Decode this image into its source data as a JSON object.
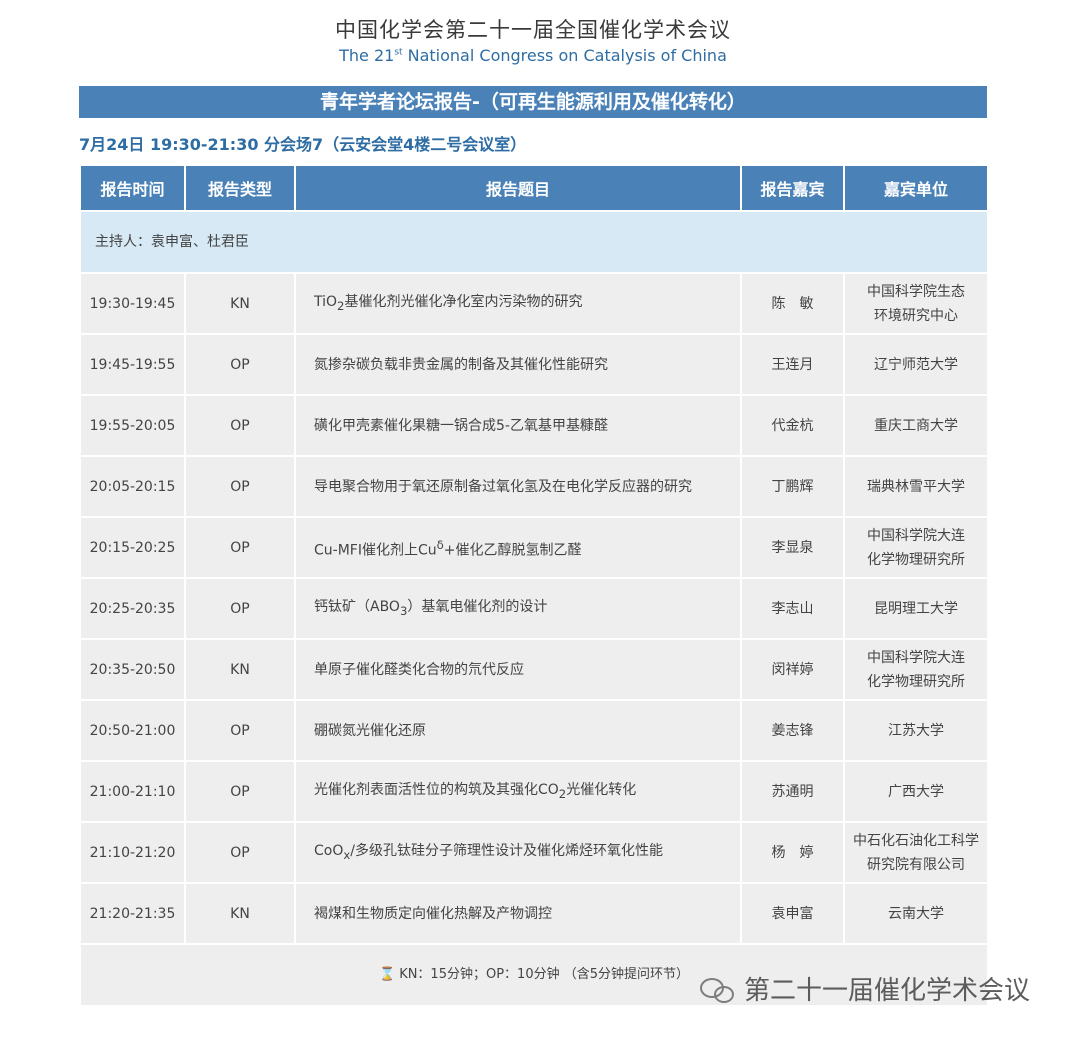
{
  "header": {
    "title_cn": "中国化学会第二十一届全国催化学术会议",
    "title_en_prefix": "The 21",
    "title_en_sup": "st",
    "title_en_suffix": " National Congress on Catalysis of China"
  },
  "banner": "青年学者论坛报告-（可再生能源利用及催化转化）",
  "session": "7月24日  19:30-21:30 分会场7（云安会堂4楼二号会议室）",
  "columns": [
    "报告时间",
    "报告类型",
    "报告题目",
    "报告嘉宾",
    "嘉宾单位"
  ],
  "host": "主持人：袁申富、杜君臣",
  "rows": [
    {
      "time": "19:30-19:45",
      "type": "KN",
      "t1": "TiO",
      "sub": "2",
      "t2": "基催化剂光催化净化室内污染物的研究",
      "speaker": "陈　敏",
      "aff1": "中国科学院生态",
      "aff2": "环境研究中心"
    },
    {
      "time": "19:45-19:55",
      "type": "OP",
      "t1": "氮掺杂碳负载非贵金属的制备及其催化性能研究",
      "sub": "",
      "t2": "",
      "speaker": "王连月",
      "aff1": "辽宁师范大学",
      "aff2": ""
    },
    {
      "time": "19:55-20:05",
      "type": "OP",
      "t1": "磺化甲壳素催化果糖一锅合成5-乙氧基甲基糠醛",
      "sub": "",
      "t2": "",
      "speaker": "代金杭",
      "aff1": "重庆工商大学",
      "aff2": ""
    },
    {
      "time": "20:05-20:15",
      "type": "OP",
      "t1": "导电聚合物用于氧还原制备过氧化氢及在电化学反应器的研究",
      "sub": "",
      "t2": "",
      "speaker": "丁鹏辉",
      "aff1": "瑞典林雪平大学",
      "aff2": ""
    },
    {
      "time": "20:15-20:25",
      "type": "OP",
      "t1": "Cu-MFI催化剂上Cu",
      "sup": "δ",
      "t2": "+催化乙醇脱氢制乙醛",
      "speaker": "李显泉",
      "aff1": "中国科学院大连",
      "aff2": "化学物理研究所"
    },
    {
      "time": "20:25-20:35",
      "type": "OP",
      "t1": "钙钛矿（ABO",
      "sub": "3",
      "t2": "）基氧电催化剂的设计",
      "speaker": "李志山",
      "aff1": "昆明理工大学",
      "aff2": ""
    },
    {
      "time": "20:35-20:50",
      "type": "KN",
      "t1": "单原子催化醛类化合物的氘代反应",
      "sub": "",
      "t2": "",
      "speaker": "闵祥婷",
      "aff1": "中国科学院大连",
      "aff2": "化学物理研究所"
    },
    {
      "time": "20:50-21:00",
      "type": "OP",
      "t1": "硼碳氮光催化还原",
      "sub": "",
      "t2": "",
      "speaker": "姜志锋",
      "aff1": "江苏大学",
      "aff2": ""
    },
    {
      "time": "21:00-21:10",
      "type": "OP",
      "t1": "光催化剂表面活性位的构筑及其强化CO",
      "sub": "2",
      "t2": "光催化转化",
      "speaker": "苏通明",
      "aff1": "广西大学",
      "aff2": ""
    },
    {
      "time": "21:10-21:20",
      "type": "OP",
      "t1": "CoO",
      "sub": "x",
      "t2": "/多级孔钛硅分子筛理性设计及催化烯烃环氧化性能",
      "speaker": "杨　婷",
      "aff1": "中石化石油化工科学",
      "aff2": "研究院有限公司"
    },
    {
      "time": "21:20-21:35",
      "type": "KN",
      "t1": "褐煤和生物质定向催化热解及产物调控",
      "sub": "",
      "t2": "",
      "speaker": "袁申富",
      "aff1": "云南大学",
      "aff2": ""
    }
  ],
  "footer_note": "KN：15分钟；OP：10分钟 （含5分钟提问环节）",
  "watermark": "第二十一届催化学术会议",
  "colors": {
    "header_blue": "#4a82b8",
    "host_row": "#d6e9f5",
    "row_gray": "#eeeeee",
    "title_blue": "#2e6da4"
  }
}
